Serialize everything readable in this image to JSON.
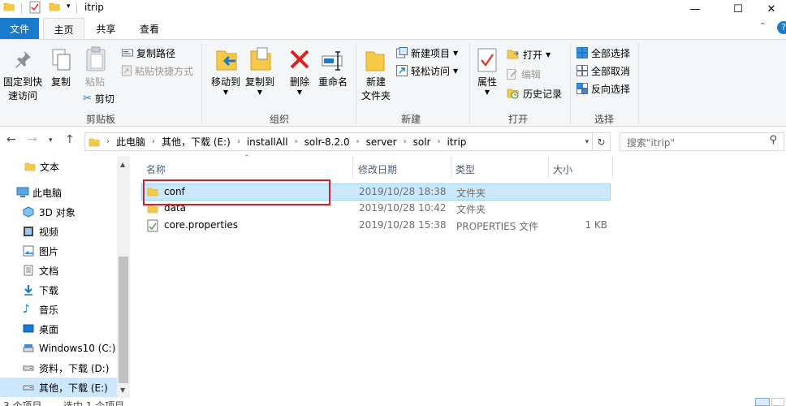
{
  "window": {
    "title": "itrip",
    "minimize_glyph": "—",
    "maximize_glyph": "☐",
    "close_glyph": "✕"
  },
  "tabs": {
    "file": "文件",
    "home": "主页",
    "share": "共享",
    "view": "查看"
  },
  "ribbon": {
    "clipboard": {
      "pin": "固定到快\n速访问",
      "pin_line1": "固定到快",
      "pin_line2": "速访问",
      "copy": "复制",
      "paste": "粘贴",
      "copy_path": "复制路径",
      "paste_shortcut": "粘贴快捷方式",
      "cut": "剪切",
      "group": "剪贴板"
    },
    "organize": {
      "move_to": "移动到",
      "copy_to": "复制到",
      "delete": "删除",
      "rename": "重命名",
      "group": "组织"
    },
    "new": {
      "new_folder_line1": "新建",
      "new_folder_line2": "文件夹",
      "new_item": "新建项目",
      "easy_access": "轻松访问",
      "group": "新建"
    },
    "open": {
      "properties": "属性",
      "open": "打开",
      "edit": "编辑",
      "history": "历史记录",
      "group": "打开"
    },
    "select": {
      "select_all": "全部选择",
      "select_none": "全部取消",
      "invert": "反向选择",
      "group": "选择"
    }
  },
  "address": {
    "crumbs": [
      "此电脑",
      "其他，下载 (E:)",
      "installAll",
      "solr-8.2.0",
      "server",
      "solr",
      "itrip"
    ],
    "search_placeholder": "搜索\"itrip\""
  },
  "nav": {
    "items": [
      {
        "label": "文本",
        "icon": "folder-icon"
      },
      {
        "label": "此电脑",
        "icon": "computer-icon"
      },
      {
        "label": "3D 对象",
        "icon": "cube-icon"
      },
      {
        "label": "视频",
        "icon": "video-icon"
      },
      {
        "label": "图片",
        "icon": "picture-icon"
      },
      {
        "label": "文档",
        "icon": "document-icon"
      },
      {
        "label": "下载",
        "icon": "download-icon"
      },
      {
        "label": "音乐",
        "icon": "music-icon"
      },
      {
        "label": "桌面",
        "icon": "desktop-icon"
      },
      {
        "label": "Windows10 (C:)",
        "icon": "drive-icon"
      },
      {
        "label": "资料，下载 (D:)",
        "icon": "drive-icon"
      },
      {
        "label": "其他，下载 (E:)",
        "icon": "drive-icon"
      }
    ]
  },
  "columns": {
    "name": "名称",
    "modified": "修改日期",
    "type": "类型",
    "size": "大小"
  },
  "files": [
    {
      "name": "conf",
      "modified": "2019/10/28 18:38",
      "type": "文件夹",
      "size": "",
      "icon": "folder-icon"
    },
    {
      "name": "data",
      "modified": "2019/10/28 10:42",
      "type": "文件夹",
      "size": "",
      "icon": "folder-icon"
    },
    {
      "name": "core.properties",
      "modified": "2019/10/28 15:38",
      "type": "PROPERTIES 文件",
      "size": "1 KB",
      "icon": "properties-file-icon"
    }
  ],
  "status": {
    "count": "3 个项目",
    "selected": "选中 1 个项目"
  },
  "colors": {
    "accent": "#1979ca",
    "selection": "#cce8ff",
    "highlight_box": "#d0202a"
  }
}
